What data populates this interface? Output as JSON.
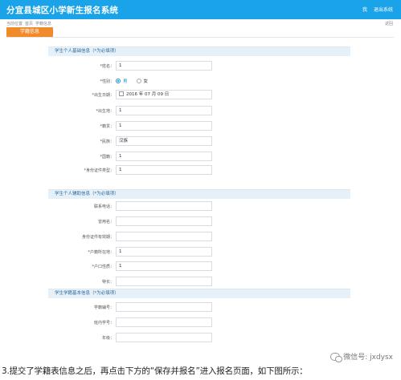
{
  "header": {
    "title": "分宜县城区小学新生报名系统",
    "right_links": [
      "我",
      "退出系统"
    ]
  },
  "breadcrumb": [
    "当前位置",
    "首页",
    "学籍信息"
  ],
  "back": "返回",
  "tab": "学籍信息",
  "basic": {
    "title": "学生个人基础信息（*为必填项）",
    "name_label": "*姓名：",
    "name_value": "1",
    "gender_label": "*性别：",
    "gender_male": "男",
    "gender_female": "女",
    "dob_label": "*出生日期：",
    "dob_value": "2016 年 07 月 09 日",
    "birthplace_label": "*出生地：",
    "birthplace_value": "1",
    "native_label": "*籍贯：",
    "native_value": "1",
    "ethnic_label": "*民族：",
    "ethnic_value": "汉族",
    "nationality_label": "*国籍：",
    "nationality_value": "1",
    "idtype_label": "*身份证件类型：",
    "idtype_value": "1"
  },
  "aux": {
    "title": "学生个人辅助信息（*为必填项）",
    "phone_label": "联系电话：",
    "former_name_label": "曾用名：",
    "id_expiry_label": "身份证件有效期：",
    "hukou_label": "*户籍所在地：",
    "hukou_value": "1",
    "hukou_nature_label": "*户口性质：",
    "hukou_nature_value": "1",
    "specialty_label": "特长："
  },
  "school": {
    "title": "学生学籍基本信息（*为必填项）",
    "student_no_label": "学籍辅号：",
    "inschool_no_label": "班内学号：",
    "grade_label": "年级："
  },
  "caption": "3.提交了学籍表信息之后，再点击下方的“保存并报名”进入报名页面，如下图所示：",
  "watermark": "微信号: jxdysx"
}
